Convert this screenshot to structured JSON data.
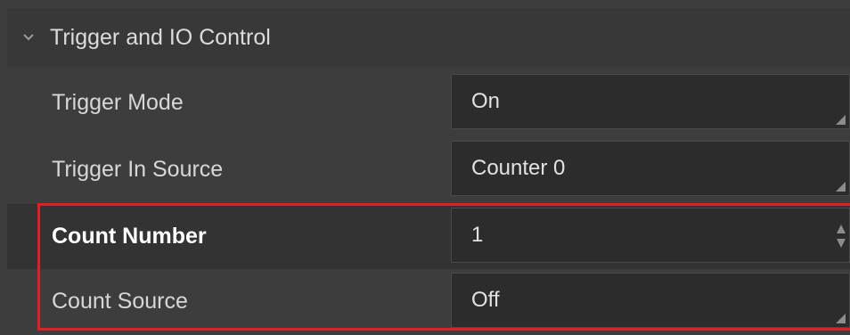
{
  "section": {
    "title": "Trigger and IO Control",
    "icon": "chevron-down-icon"
  },
  "rows": [
    {
      "label": "Trigger Mode",
      "value": "On",
      "control": "dropdown"
    },
    {
      "label": "Trigger In Source",
      "value": "Counter 0",
      "control": "dropdown"
    },
    {
      "label": "Count Number",
      "value": "1",
      "control": "spinner"
    },
    {
      "label": "Count Source",
      "value": "Off",
      "control": "dropdown"
    }
  ],
  "colors": {
    "background": "#3d3d3d",
    "value_box": "#2c2c2c",
    "highlight": "#e31e24"
  }
}
